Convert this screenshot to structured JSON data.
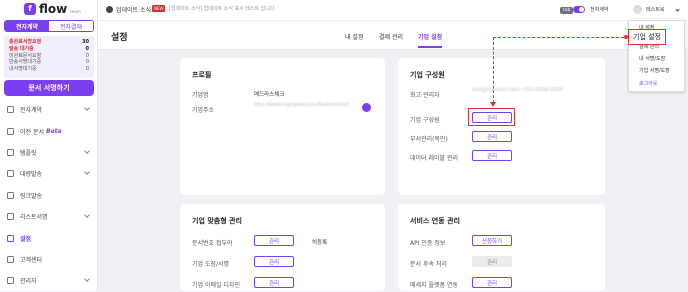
{
  "brand": {
    "name": "flow",
    "sub": "team"
  },
  "sidebar": {
    "segments": [
      "전자계약",
      "전자결재"
    ],
    "stats": [
      {
        "label": "총완료서명요청",
        "value": "30",
        "highlight": true
      },
      {
        "label": "발송 대기중",
        "value": "0",
        "highlight": true
      },
      {
        "label": "미완료문서요청",
        "value": "0"
      },
      {
        "label": "반송서명대기중",
        "value": "0"
      },
      {
        "label": "내서명대기중",
        "value": "0"
      }
    ],
    "sign_button": "문서 서명하기",
    "menu": [
      {
        "label": "전자계약",
        "chevron": true
      },
      {
        "label": "이전 문서",
        "beta": "Beta",
        "chevron": false
      },
      {
        "label": "템플릿",
        "chevron": true
      },
      {
        "label": "대량발송",
        "chevron": true
      },
      {
        "label": "링크발송",
        "chevron": false
      },
      {
        "label": "리스트서명",
        "chevron": true
      },
      {
        "label": "설정",
        "chevron": false,
        "active": true
      },
      {
        "label": "고객센터",
        "chevron": false
      },
      {
        "label": "관리자",
        "chevron": true
      }
    ]
  },
  "topbar": {
    "update_label": "업데이트 소식",
    "new_badge": "NEW",
    "message": "[업데이트 소식] 업데이트 소식 표시 테스트 입니다.",
    "tab_badge": "tab",
    "switch_label": "전자계약",
    "user_name": "테스트북"
  },
  "page": {
    "title": "설정",
    "tabs": [
      "내 설정",
      "결제 관리",
      "기업 설정"
    ],
    "active_tab": 2
  },
  "profile_card": {
    "title": "프로필",
    "rows": [
      {
        "label": "기업명",
        "value": "메드라스체크"
      },
      {
        "label": "기업주소",
        "value": "http://www.signglow.com/flowcontract"
      }
    ]
  },
  "members_card": {
    "title": "기업 구성원",
    "admin_label": "최고 관리자",
    "admin_value": "test@contract.com / 010-0000-0000",
    "rows": [
      {
        "label": "기업 구성원",
        "button": "관리",
        "highlight": true
      },
      {
        "label": "부서관리(복민)",
        "button": "관리"
      },
      {
        "label": "데이터 레이블 관리",
        "button": "관리"
      }
    ]
  },
  "custom_card": {
    "title": "기업 맞춤형 관리",
    "rows": [
      {
        "label": "문서번호 접두어",
        "button": "관리",
        "note": "허등록"
      },
      {
        "label": "기업 도장/서명",
        "button": "관리"
      },
      {
        "label": "기업 이메일 디자인",
        "button": "관리"
      }
    ]
  },
  "service_card": {
    "title": "서비스 연동 관리",
    "rows": [
      {
        "label": "API 인증 정보",
        "button": "신청하기",
        "type": "outline"
      },
      {
        "label": "문서 후속 처리",
        "button": "관리",
        "type": "gray"
      },
      {
        "label": "메세지 플랫폼 연동",
        "button": "관리",
        "type": "outline"
      }
    ]
  },
  "dropdown": {
    "items": [
      "내 설정",
      "결제 관리",
      "내 서명/도장",
      "기업 서명/도장",
      "로그아웃"
    ]
  },
  "callout": {
    "label": "기업 설정",
    "color": "#e0312b"
  }
}
